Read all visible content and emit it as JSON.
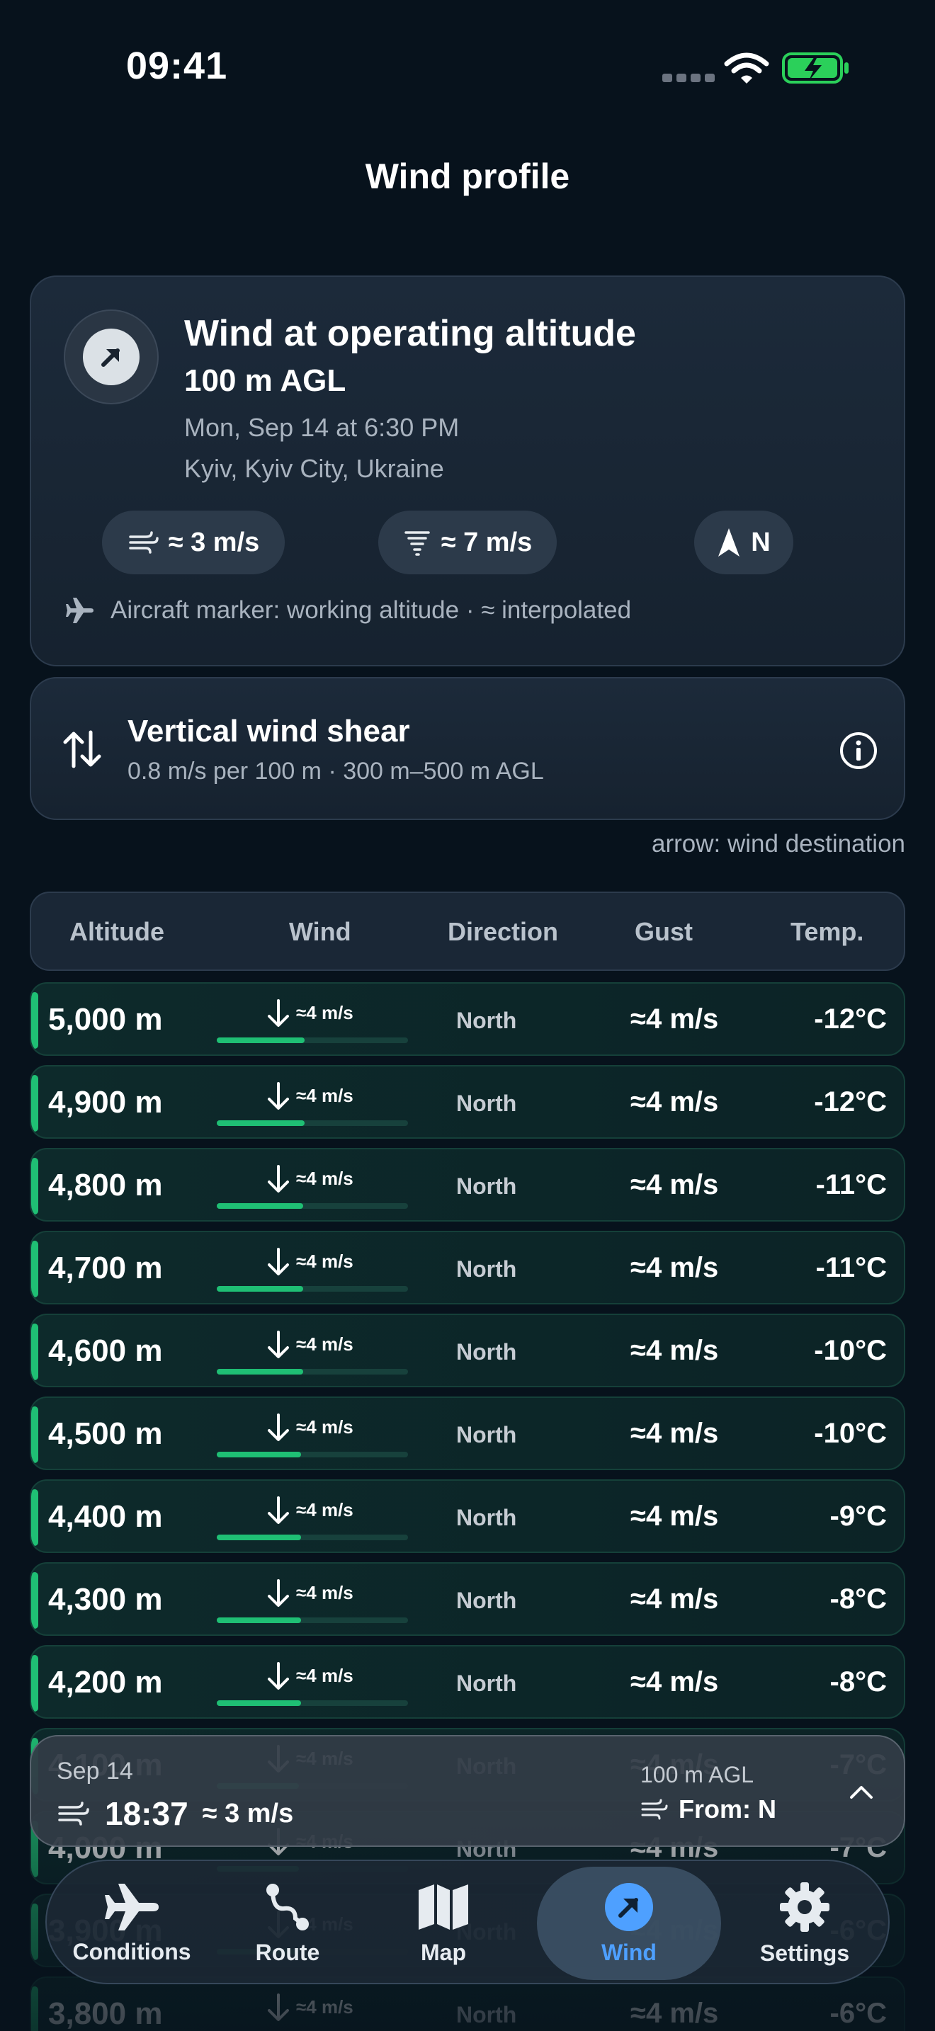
{
  "status_bar": {
    "time": "09:41"
  },
  "page_title": "Wind profile",
  "summary": {
    "title": "Wind at operating altitude",
    "altitude": "100 m AGL",
    "datetime": "Mon, Sep 14 at 6:30 PM",
    "location": "Kyiv, Kyiv City, Ukraine",
    "chips": {
      "wind": "≈ 3 m/s",
      "gust": "≈ 7 m/s",
      "direction": "N"
    },
    "note": "Aircraft marker: working altitude · ≈ interpolated"
  },
  "shear": {
    "title": "Vertical wind shear",
    "subtitle": "0.8 m/s per 100 m · 300 m–500 m AGL"
  },
  "arrow_note": "arrow: wind destination",
  "table": {
    "headers": [
      "Altitude",
      "Wind",
      "Direction",
      "Gust",
      "Temp."
    ],
    "rows": [
      {
        "altitude": "5,000 m",
        "wind": "≈4 m/s",
        "wind_fraction": 0.46,
        "direction": "North",
        "gust": "≈4 m/s",
        "temp": "-12°C"
      },
      {
        "altitude": "4,900 m",
        "wind": "≈4 m/s",
        "wind_fraction": 0.46,
        "direction": "North",
        "gust": "≈4 m/s",
        "temp": "-12°C"
      },
      {
        "altitude": "4,800 m",
        "wind": "≈4 m/s",
        "wind_fraction": 0.45,
        "direction": "North",
        "gust": "≈4 m/s",
        "temp": "-11°C"
      },
      {
        "altitude": "4,700 m",
        "wind": "≈4 m/s",
        "wind_fraction": 0.45,
        "direction": "North",
        "gust": "≈4 m/s",
        "temp": "-11°C"
      },
      {
        "altitude": "4,600 m",
        "wind": "≈4 m/s",
        "wind_fraction": 0.45,
        "direction": "North",
        "gust": "≈4 m/s",
        "temp": "-10°C"
      },
      {
        "altitude": "4,500 m",
        "wind": "≈4 m/s",
        "wind_fraction": 0.44,
        "direction": "North",
        "gust": "≈4 m/s",
        "temp": "-10°C"
      },
      {
        "altitude": "4,400 m",
        "wind": "≈4 m/s",
        "wind_fraction": 0.44,
        "direction": "North",
        "gust": "≈4 m/s",
        "temp": "-9°C"
      },
      {
        "altitude": "4,300 m",
        "wind": "≈4 m/s",
        "wind_fraction": 0.44,
        "direction": "North",
        "gust": "≈4 m/s",
        "temp": "-8°C"
      },
      {
        "altitude": "4,200 m",
        "wind": "≈4 m/s",
        "wind_fraction": 0.44,
        "direction": "North",
        "gust": "≈4 m/s",
        "temp": "-8°C"
      },
      {
        "altitude": "4,100 m",
        "wind": "≈4 m/s",
        "wind_fraction": 0.43,
        "direction": "North",
        "gust": "≈4 m/s",
        "temp": "-7°C"
      },
      {
        "altitude": "4,000 m",
        "wind": "≈4 m/s",
        "wind_fraction": 0.43,
        "direction": "North",
        "gust": "≈4 m/s",
        "temp": "-7°C"
      },
      {
        "altitude": "3,900 m",
        "wind": "≈4 m/s",
        "wind_fraction": 0.43,
        "direction": "North",
        "gust": "≈4 m/s",
        "temp": "-6°C"
      },
      {
        "altitude": "3,800 m",
        "wind": "≈4 m/s",
        "wind_fraction": 0.43,
        "direction": "North",
        "gust": "≈4 m/s",
        "temp": "-6°C"
      }
    ]
  },
  "mini_panel": {
    "date": "Sep 14",
    "time": "18:37",
    "speed": "≈ 3 m/s",
    "altitude": "100 m AGL",
    "from": "From: N"
  },
  "tabs": [
    {
      "label": "Conditions",
      "icon": "airplane-icon",
      "active": false
    },
    {
      "label": "Route",
      "icon": "route-icon",
      "active": false
    },
    {
      "label": "Map",
      "icon": "map-icon",
      "active": false
    },
    {
      "label": "Wind",
      "icon": "wind-arrow-icon",
      "active": true
    },
    {
      "label": "Settings",
      "icon": "gear-icon",
      "active": false
    }
  ],
  "colors": {
    "accent_green": "#1fbf74",
    "active_tab_blue": "#4ea0ff",
    "background": "#07121c"
  }
}
